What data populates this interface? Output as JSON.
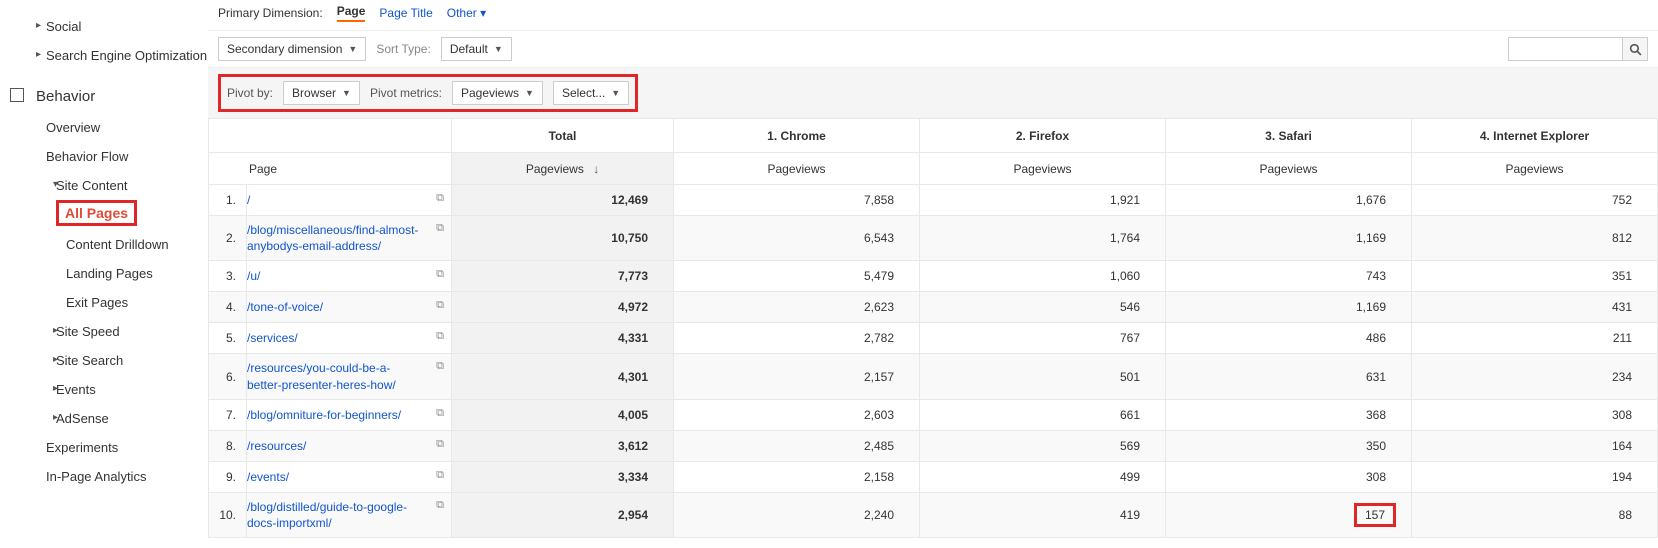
{
  "sidebar": {
    "items_top": [
      {
        "label": "Social"
      },
      {
        "label": "Search Engine Optimization"
      }
    ],
    "behavior_label": "Behavior",
    "behavior_children": [
      {
        "label": "Overview"
      },
      {
        "label": "Behavior Flow"
      }
    ],
    "site_content_label": "Site Content",
    "site_content_children": [
      {
        "label": "All Pages",
        "active": true
      },
      {
        "label": "Content Drilldown"
      },
      {
        "label": "Landing Pages"
      },
      {
        "label": "Exit Pages"
      }
    ],
    "more": [
      {
        "label": "Site Speed"
      },
      {
        "label": "Site Search"
      },
      {
        "label": "Events"
      },
      {
        "label": "AdSense"
      }
    ],
    "tail": [
      {
        "label": "Experiments"
      },
      {
        "label": "In-Page Analytics"
      }
    ]
  },
  "controls": {
    "primary_dim_label": "Primary Dimension:",
    "primary_dim_active": "Page",
    "primary_dim_options": [
      "Page Title",
      "Other"
    ],
    "secondary_dim_label": "Secondary dimension",
    "sort_type_label": "Sort Type:",
    "sort_type_value": "Default",
    "search_placeholder": "",
    "pivot_by_label": "Pivot by:",
    "pivot_by_value": "Browser",
    "pivot_metrics_label": "Pivot metrics:",
    "pivot_metrics_value": "Pageviews",
    "pivot_select_value": "Select..."
  },
  "table": {
    "dimension_header": "Page",
    "pivot_groups": [
      "Total",
      "1. Chrome",
      "2. Firefox",
      "3. Safari",
      "4. Internet Explorer"
    ],
    "metric_header": "Pageviews",
    "rows": [
      {
        "n": "1.",
        "page": "/",
        "total": "12,469",
        "c1": "7,858",
        "c2": "1,921",
        "c3": "1,676",
        "c4": "752"
      },
      {
        "n": "2.",
        "page": "/blog/miscellaneous/find-almost-anybodys-email-address/",
        "total": "10,750",
        "c1": "6,543",
        "c2": "1,764",
        "c3": "1,169",
        "c4": "812"
      },
      {
        "n": "3.",
        "page": "/u/",
        "total": "7,773",
        "c1": "5,479",
        "c2": "1,060",
        "c3": "743",
        "c4": "351"
      },
      {
        "n": "4.",
        "page": "/tone-of-voice/",
        "total": "4,972",
        "c1": "2,623",
        "c2": "546",
        "c3": "1,169",
        "c4": "431"
      },
      {
        "n": "5.",
        "page": "/services/",
        "total": "4,331",
        "c1": "2,782",
        "c2": "767",
        "c3": "486",
        "c4": "211"
      },
      {
        "n": "6.",
        "page": "/resources/you-could-be-a-better-presenter-heres-how/",
        "total": "4,301",
        "c1": "2,157",
        "c2": "501",
        "c3": "631",
        "c4": "234"
      },
      {
        "n": "7.",
        "page": "/blog/omniture-for-beginners/",
        "total": "4,005",
        "c1": "2,603",
        "c2": "661",
        "c3": "368",
        "c4": "308"
      },
      {
        "n": "8.",
        "page": "/resources/",
        "total": "3,612",
        "c1": "2,485",
        "c2": "569",
        "c3": "350",
        "c4": "164"
      },
      {
        "n": "9.",
        "page": "/events/",
        "total": "3,334",
        "c1": "2,158",
        "c2": "499",
        "c3": "308",
        "c4": "194"
      },
      {
        "n": "10.",
        "page": "/blog/distilled/guide-to-google-docs-importxml/",
        "total": "2,954",
        "c1": "2,240",
        "c2": "419",
        "c3": "157",
        "c4": "88",
        "c3_annot": true
      }
    ]
  }
}
